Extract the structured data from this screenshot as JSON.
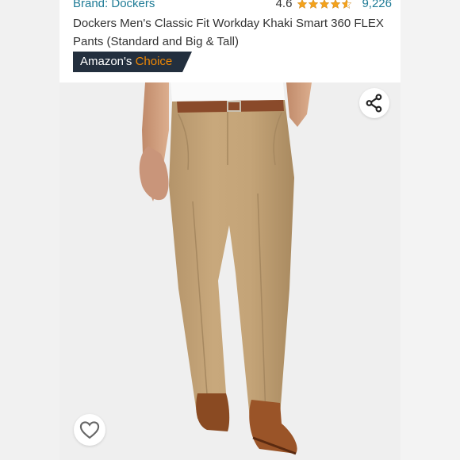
{
  "product": {
    "brand_label": "Brand: Dockers",
    "rating": "4.6",
    "stars": 4.6,
    "review_count": "9,226",
    "title": "Dockers Men's Classic Fit Workday Khaki Smart 360 FLEX Pants (Standard and Big & Tall)",
    "badge": {
      "prefix": "Amazon's",
      "accent": "Choice"
    }
  },
  "icons": {
    "share": "share-icon",
    "heart": "heart-outline-icon",
    "star": "star-icon"
  },
  "colors": {
    "link": "#1e7b96",
    "star": "#f4a21b",
    "badge_bg": "#232f3e",
    "badge_accent": "#f08804",
    "khaki": "#c4a47a"
  }
}
